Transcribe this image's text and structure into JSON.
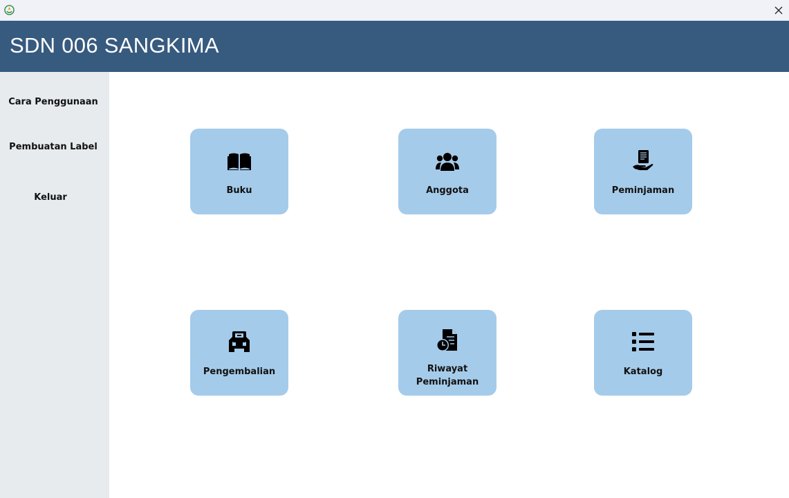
{
  "window": {
    "app_icon": "school-logo-icon",
    "close_icon": "close-icon"
  },
  "header": {
    "title": "SDN 006 SANGKIMA",
    "background": "#375a7f"
  },
  "sidebar": {
    "items": [
      {
        "label": "Cara Penggunaan"
      },
      {
        "label": "Pembuatan Label"
      },
      {
        "label": "Keluar"
      }
    ]
  },
  "tiles": [
    {
      "label": "Buku",
      "icon": "open-book-icon"
    },
    {
      "label": "Anggota",
      "icon": "users-group-icon"
    },
    {
      "label": "Peminjaman",
      "icon": "hand-holding-book-icon"
    },
    {
      "label": "Pengembalian",
      "icon": "book-return-icon"
    },
    {
      "label": "Riwayat Peminjaman",
      "icon": "document-clock-icon"
    },
    {
      "label": "Katalog",
      "icon": "list-icon"
    }
  ],
  "colors": {
    "tile": "#a5cbea",
    "sidebar": "#e8ebee"
  }
}
